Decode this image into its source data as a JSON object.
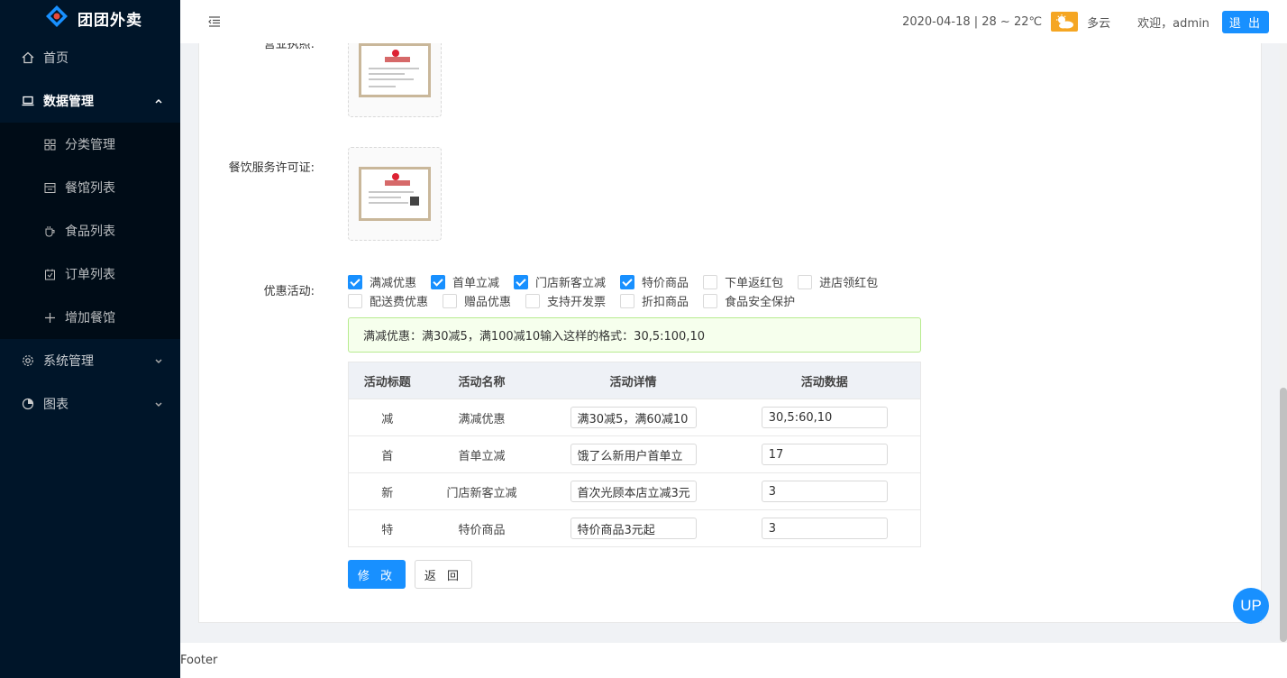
{
  "app": {
    "logo_text": "团团外卖"
  },
  "sidebar": {
    "items": [
      {
        "label": "首页",
        "icon": "home-icon"
      },
      {
        "label": "数据管理",
        "icon": "laptop-icon",
        "expanded": true,
        "children": [
          {
            "label": "分类管理",
            "icon": "grid-icon"
          },
          {
            "label": "餐馆列表",
            "icon": "store-icon"
          },
          {
            "label": "食品列表",
            "icon": "cup-icon"
          },
          {
            "label": "订单列表",
            "icon": "calendar-icon"
          },
          {
            "label": "增加餐馆",
            "icon": "plus-icon"
          }
        ]
      },
      {
        "label": "系统管理",
        "icon": "gear-icon"
      },
      {
        "label": "图表",
        "icon": "pie-chart-icon"
      }
    ]
  },
  "header": {
    "date_weather": "2020-04-18 | 28 ~ 22℃",
    "weather_text": "多云",
    "welcome": "欢迎，admin",
    "logout_label": "退 出"
  },
  "form": {
    "license_label": "营业执照:",
    "catering_license_label": "餐饮服务许可证:",
    "activities_label": "优惠活动:",
    "activities": [
      {
        "label": "满减优惠",
        "checked": true
      },
      {
        "label": "首单立减",
        "checked": true
      },
      {
        "label": "门店新客立减",
        "checked": true
      },
      {
        "label": "特价商品",
        "checked": true
      },
      {
        "label": "下单返红包",
        "checked": false
      },
      {
        "label": "进店领红包",
        "checked": false
      },
      {
        "label": "配送费优惠",
        "checked": false
      },
      {
        "label": "赠品优惠",
        "checked": false
      },
      {
        "label": "支持开发票",
        "checked": false
      },
      {
        "label": "折扣商品",
        "checked": false
      },
      {
        "label": "食品安全保护",
        "checked": false
      }
    ],
    "alert_text": "满减优惠：满30减5，满100减10输入这样的格式：30,5:100,10",
    "table": {
      "headers": [
        "活动标题",
        "活动名称",
        "活动详情",
        "活动数据"
      ],
      "rows": [
        {
          "title": "减",
          "name": "满减优惠",
          "detail": "满30减5，满60减10",
          "data": "30,5:60,10"
        },
        {
          "title": "首",
          "name": "首单立减",
          "detail": "饿了么新用户首单立",
          "data": "17"
        },
        {
          "title": "新",
          "name": "门店新客立减",
          "detail": "首次光顾本店立减3元",
          "data": "3"
        },
        {
          "title": "特",
          "name": "特价商品",
          "detail": "特价商品3元起",
          "data": "3"
        }
      ]
    },
    "submit_label": "修 改",
    "back_label": "返 回"
  },
  "footer": {
    "text": "Footer"
  },
  "up_button": "UP",
  "colors": {
    "sidebar_bg": "#001529",
    "primary": "#1890ff",
    "alert_bg": "#f6ffed",
    "weather_badge": "#f5a623"
  }
}
